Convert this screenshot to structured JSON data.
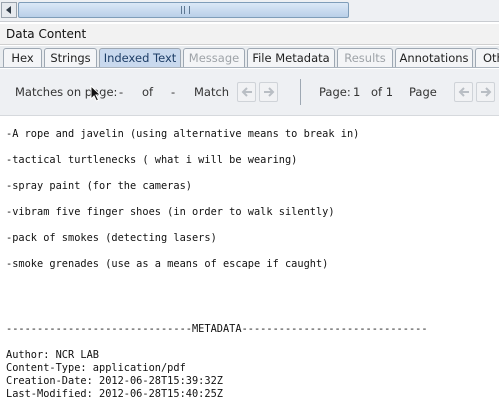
{
  "panel_title": "Data Content",
  "tabs": [
    {
      "label": "Hex",
      "state": "normal"
    },
    {
      "label": "Strings",
      "state": "normal"
    },
    {
      "label": "Indexed Text",
      "state": "active"
    },
    {
      "label": "Message",
      "state": "disabled"
    },
    {
      "label": "File Metadata",
      "state": "normal"
    },
    {
      "label": "Results",
      "state": "disabled"
    },
    {
      "label": "Annotations",
      "state": "normal"
    },
    {
      "label": "Oth",
      "state": "normal"
    }
  ],
  "toolbar": {
    "matches_label": "Matches on page:",
    "matches_value": "-",
    "of_label": "of",
    "matches_total": "-",
    "match_label": "Match",
    "page_label": "Page:",
    "page_current": "1",
    "page_of": "of 1",
    "page_word": "Page"
  },
  "content": {
    "lines": [
      "-A rope and javelin (using alternative means to break in)",
      "-tactical turtlenecks ( what i will be wearing)",
      "-spray paint (for the cameras)",
      "-vibram five finger shoes (in order to walk silently)",
      "-pack of smokes (detecting lasers)",
      "-smoke grenades (use as a means of escape if caught)"
    ],
    "metadata_header": "------------------------------METADATA------------------------------",
    "metadata": [
      "Author: NCR LAB",
      "Content-Type: application/pdf",
      "Creation-Date: 2012-06-28T15:39:32Z",
      "Last-Modified: 2012-06-28T15:40:25Z"
    ]
  },
  "colors": {
    "active_tab": "#c9d9ee",
    "scroll_thumb": "#b9cfe8",
    "toolbar_bg": "#eef0f3"
  }
}
